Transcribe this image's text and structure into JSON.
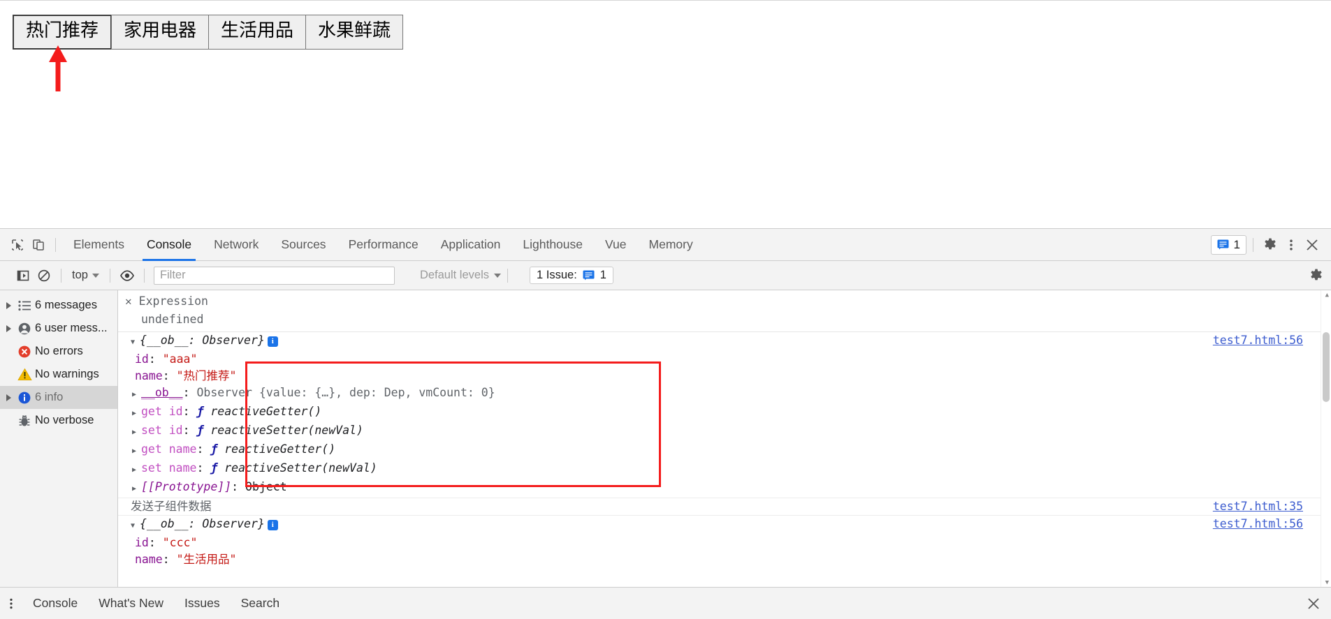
{
  "webpage": {
    "buttons": [
      {
        "label": "热门推荐",
        "selected": true
      },
      {
        "label": "家用电器",
        "selected": false
      },
      {
        "label": "生活用品",
        "selected": false
      },
      {
        "label": "水果鲜蔬",
        "selected": false
      }
    ],
    "annotation_color": "#f41c1c"
  },
  "devtools": {
    "tabs": [
      {
        "label": "Elements",
        "active": false
      },
      {
        "label": "Console",
        "active": true
      },
      {
        "label": "Network",
        "active": false
      },
      {
        "label": "Sources",
        "active": false
      },
      {
        "label": "Performance",
        "active": false
      },
      {
        "label": "Application",
        "active": false
      },
      {
        "label": "Lighthouse",
        "active": false
      },
      {
        "label": "Vue",
        "active": false
      },
      {
        "label": "Memory",
        "active": false
      }
    ],
    "message_badge_count": "1",
    "accent_color": "#1a73e8",
    "icons": {
      "inspect": "inspect-element-icon",
      "device": "device-toolbar-icon",
      "settings": "gear-icon",
      "more": "more-options-icon",
      "close": "close-icon"
    },
    "filterbar": {
      "sidebar_toggle": "console-sidebar-toggle-icon",
      "clear": "clear-console-icon",
      "context": "top",
      "eye": "live-expression-icon",
      "filter_placeholder": "Filter",
      "filter_value": "",
      "levels_label": "Default levels",
      "issues_label": "1 Issue:",
      "issues_count": "1"
    },
    "sidebar": [
      {
        "label": "6 messages",
        "icon": "list-icon",
        "expandable": true,
        "selected": false
      },
      {
        "label": "6 user mess...",
        "icon": "user-icon",
        "expandable": true,
        "selected": false
      },
      {
        "label": "No errors",
        "icon": "error-icon",
        "expandable": false,
        "selected": false
      },
      {
        "label": "No warnings",
        "icon": "warning-icon",
        "expandable": false,
        "selected": false
      },
      {
        "label": "6 info",
        "icon": "info-icon",
        "expandable": true,
        "selected": true
      },
      {
        "label": "No verbose",
        "icon": "bug-icon",
        "expandable": false,
        "selected": false
      }
    ],
    "live_expression": {
      "name": "Expression",
      "value": "undefined"
    },
    "console": {
      "entry1": {
        "header": "{__ob__: Observer}",
        "source": "test7.html:56",
        "rows": [
          {
            "key": "id",
            "sep": ": ",
            "value": "\"aaa\"",
            "kind": "string"
          },
          {
            "key": "name",
            "sep": ": ",
            "value": "\"热门推荐\"",
            "kind": "string"
          },
          {
            "key": "__ob__",
            "sep": ": ",
            "value": "Observer {value: {…}, dep: Dep, vmCount: 0}",
            "kind": "object"
          },
          {
            "key": "get id",
            "sep": ": ",
            "value": "reactiveGetter()",
            "kind": "fn"
          },
          {
            "key": "set id",
            "sep": ": ",
            "value": "reactiveSetter(newVal)",
            "kind": "fn"
          },
          {
            "key": "get name",
            "sep": ": ",
            "value": "reactiveGetter()",
            "kind": "fn"
          },
          {
            "key": "set name",
            "sep": ": ",
            "value": "reactiveSetter(newVal)",
            "kind": "fn"
          },
          {
            "key": "[[Prototype]]",
            "sep": ": ",
            "value": "Object",
            "kind": "proto"
          }
        ]
      },
      "entry2": {
        "text": "发送子组件数据",
        "source": "test7.html:35"
      },
      "entry3": {
        "header": "{__ob__: Observer}",
        "source": "test7.html:56",
        "rows": [
          {
            "key": "id",
            "sep": ": ",
            "value": "\"ccc\"",
            "kind": "string"
          },
          {
            "key": "name",
            "sep": ": ",
            "value": "\"生活用品\"",
            "kind": "string"
          }
        ]
      }
    },
    "drawer": {
      "tabs": [
        "Console",
        "What's New",
        "Issues",
        "Search"
      ],
      "close": "close-drawer-icon"
    }
  }
}
